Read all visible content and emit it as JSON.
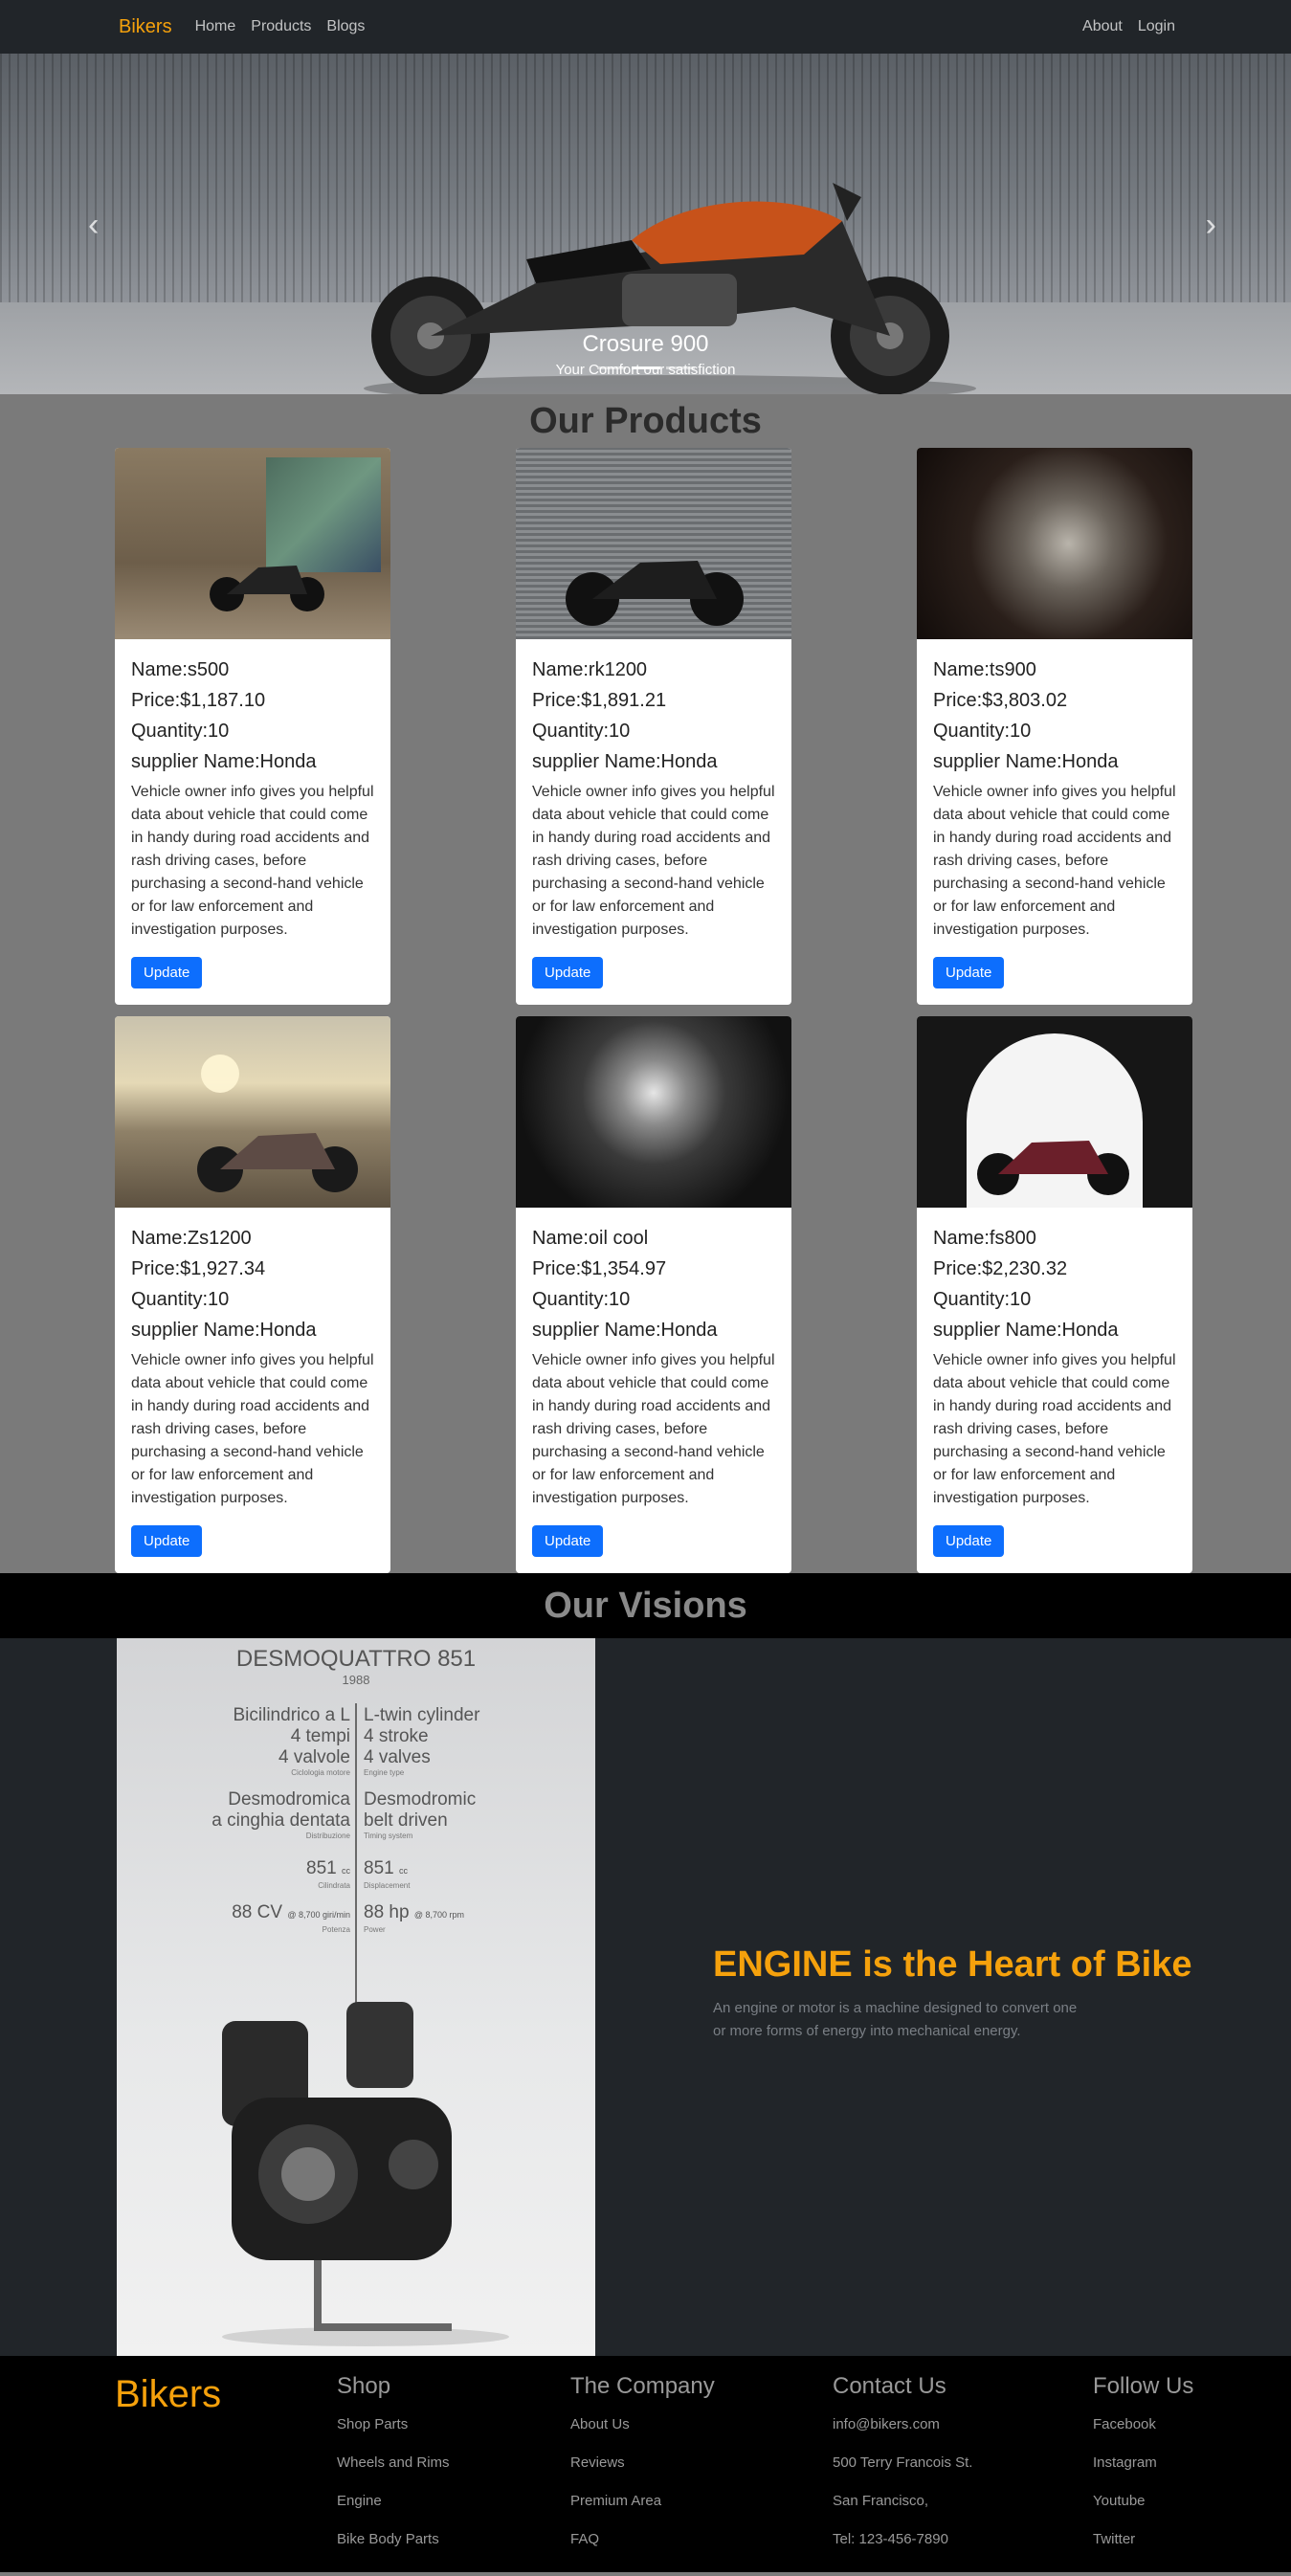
{
  "navbar": {
    "brand": "Bikers",
    "links": [
      "Home",
      "Products",
      "Blogs"
    ],
    "right_links": [
      "About",
      "Login"
    ]
  },
  "carousel": {
    "caption_title": "Crosure 900",
    "caption_text": "Your Comfort our satisfiction",
    "prev_icon": "chevron-left-icon",
    "next_icon": "chevron-right-icon",
    "slides": 3,
    "active_slide": 2
  },
  "products": {
    "title": "Our Products",
    "items": [
      {
        "name": "Name:s500",
        "price": "Price:$1,187.10",
        "quantity": "Quantity:10",
        "supplier": "supplier Name:Honda",
        "description": "Vehicle owner info gives you helpful data about vehicle that could come in handy during road accidents and rash driving cases, before purchasing a second-hand vehicle or for law enforcement and investigation purposes.",
        "button": "Update"
      },
      {
        "name": "Name:rk1200",
        "price": "Price:$1,891.21",
        "quantity": "Quantity:10",
        "supplier": "supplier Name:Honda",
        "description": "Vehicle owner info gives you helpful data about vehicle that could come in handy during road accidents and rash driving cases, before purchasing a second-hand vehicle or for law enforcement and investigation purposes.",
        "button": "Update"
      },
      {
        "name": "Name:ts900",
        "price": "Price:$3,803.02",
        "quantity": "Quantity:10",
        "supplier": "supplier Name:Honda",
        "description": "Vehicle owner info gives you helpful data about vehicle that could come in handy during road accidents and rash driving cases, before purchasing a second-hand vehicle or for law enforcement and investigation purposes.",
        "button": "Update"
      },
      {
        "name": "Name:Zs1200",
        "price": "Price:$1,927.34",
        "quantity": "Quantity:10",
        "supplier": "supplier Name:Honda",
        "description": "Vehicle owner info gives you helpful data about vehicle that could come in handy during road accidents and rash driving cases, before purchasing a second-hand vehicle or for law enforcement and investigation purposes.",
        "button": "Update"
      },
      {
        "name": "Name:oil cool",
        "price": "Price:$1,354.97",
        "quantity": "Quantity:10",
        "supplier": "supplier Name:Honda",
        "description": "Vehicle owner info gives you helpful data about vehicle that could come in handy during road accidents and rash driving cases, before purchasing a second-hand vehicle or for law enforcement and investigation purposes.",
        "button": "Update"
      },
      {
        "name": "Name:fs800",
        "price": "Price:$2,230.32",
        "quantity": "Quantity:10",
        "supplier": "supplier Name:Honda",
        "description": "Vehicle owner info gives you helpful data about vehicle that could come in handy during road accidents and rash driving cases, before purchasing a second-hand vehicle or for law enforcement and investigation purposes.",
        "button": "Update"
      }
    ]
  },
  "visions": {
    "title": "Our Visions",
    "heading": "ENGINE is the Heart of Bike",
    "description": "An engine or motor is a machine designed to convert one or more forms of energy into mechanical energy.",
    "poster": {
      "title": "DESMOQUATTRO 851",
      "year": "1988",
      "left_a": "Bicilindrico a L",
      "left_b": "4 tempi",
      "left_c": "4 valvole",
      "left_c_sub": "Ciclologia motore",
      "right_a": "L-twin cylinder",
      "right_b": "4 stroke",
      "right_c": "4 valves",
      "right_c_sub": "Engine type",
      "left_d": "Desmodromica",
      "left_e": "a cinghia dentata",
      "left_e_sub": "Distribuzione",
      "right_d": "Desmodromic",
      "right_e": "belt driven",
      "right_e_sub": "Timing system",
      "left_f": "851",
      "left_f_unit": "cc",
      "left_f_sub": "Cilindrata",
      "right_f": "851",
      "right_f_unit": "cc",
      "right_f_sub": "Displacement",
      "left_g": "88 CV",
      "left_g_rpm": "@ 8,700 giri/min",
      "left_g_sub": "Potenza",
      "right_g": "88 hp",
      "right_g_rpm": "@ 8,700 rpm",
      "right_g_sub": "Power"
    }
  },
  "footer": {
    "brand": "Bikers",
    "columns": [
      {
        "title": "Shop",
        "links": [
          "Shop Parts",
          "Wheels and Rims",
          "Engine",
          "Bike Body Parts"
        ]
      },
      {
        "title": "The Company",
        "links": [
          "About Us",
          "Reviews",
          "Premium Area",
          "FAQ"
        ]
      },
      {
        "title": "Contact Us",
        "links": [
          "info@bikers.com",
          "500 Terry Francois St.",
          "San Francisco,",
          "Tel: 123-456-7890"
        ]
      },
      {
        "title": "Follow Us",
        "links": [
          "Facebook",
          "Instagram",
          "Youtube",
          "Twitter"
        ]
      }
    ]
  },
  "colors": {
    "brand": "#f5a10c",
    "primary_button": "#0d6efd",
    "navbar": "#212529",
    "page_background": "#7a7a7a"
  }
}
